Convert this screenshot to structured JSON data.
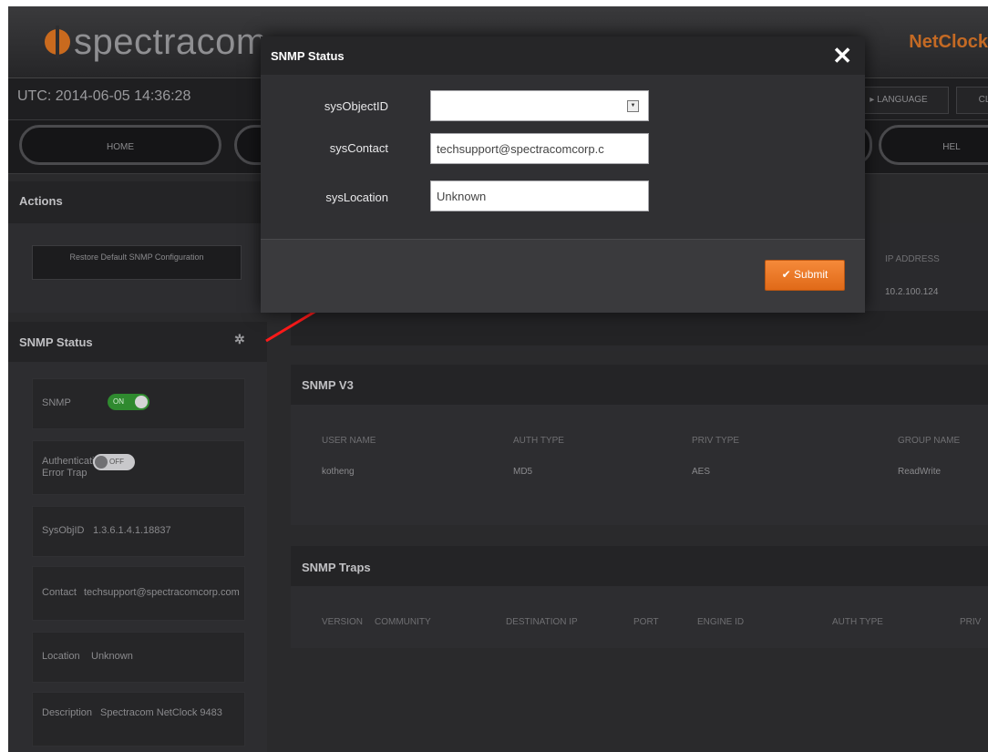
{
  "header": {
    "logo_text": "spectracom",
    "product": "NetClock"
  },
  "topbar": {
    "utc": "UTC: 2014-06-05 14:36:28",
    "buttons": [
      "LANGUAGE",
      "CL"
    ]
  },
  "nav": {
    "items": [
      "HOME",
      "",
      "",
      "HEL"
    ]
  },
  "actions_panel": {
    "title": "Actions",
    "restore_button": "Restore Default SNMP Configuration"
  },
  "snmp_status_panel": {
    "title": "SNMP Status",
    "rows": {
      "snmp_label": "SNMP",
      "snmp_toggle": "ON",
      "auth_label": "Authentication Error Trap",
      "auth_toggle": "OFF",
      "sysobjid_label": "SysObjID",
      "sysobjid_value": "1.3.6.1.4.1.18837",
      "contact_label": "Contact",
      "contact_value": "techsupport@spectracomcorp.com",
      "location_label": "Location",
      "location_value": "Unknown",
      "description_label": "Description",
      "description_value": "Spectracom NetClock 9483"
    }
  },
  "communities_panel": {
    "columns": [
      "IP ADDRESS"
    ],
    "rows": [
      [
        "10.2.100.124"
      ]
    ]
  },
  "snmp_v3_panel": {
    "title": "SNMP V3",
    "columns": [
      "USER NAME",
      "AUTH TYPE",
      "PRIV TYPE",
      "GROUP NAME"
    ],
    "rows": [
      [
        "kotheng",
        "MD5",
        "AES",
        "ReadWrite"
      ]
    ]
  },
  "snmp_traps_panel": {
    "title": "SNMP Traps",
    "columns": [
      "VERSION",
      "COMMUNITY",
      "DESTINATION IP",
      "PORT",
      "ENGINE ID",
      "AUTH TYPE",
      "PRIV"
    ]
  },
  "modal": {
    "title": "SNMP Status",
    "close": "✕",
    "fields": {
      "sysobjectid_label": "sysObjectID",
      "sysobjectid_value": "",
      "syscontact_label": "sysContact",
      "syscontact_value": "techsupport@spectracomcorp.c",
      "syslocation_label": "sysLocation",
      "syslocation_value": "Unknown"
    },
    "submit_label": "✔ Submit"
  },
  "colors": {
    "accent": "#e8782a",
    "annotation_arrow": "#ff1a1a",
    "toggle_on": "#3aa83a"
  }
}
